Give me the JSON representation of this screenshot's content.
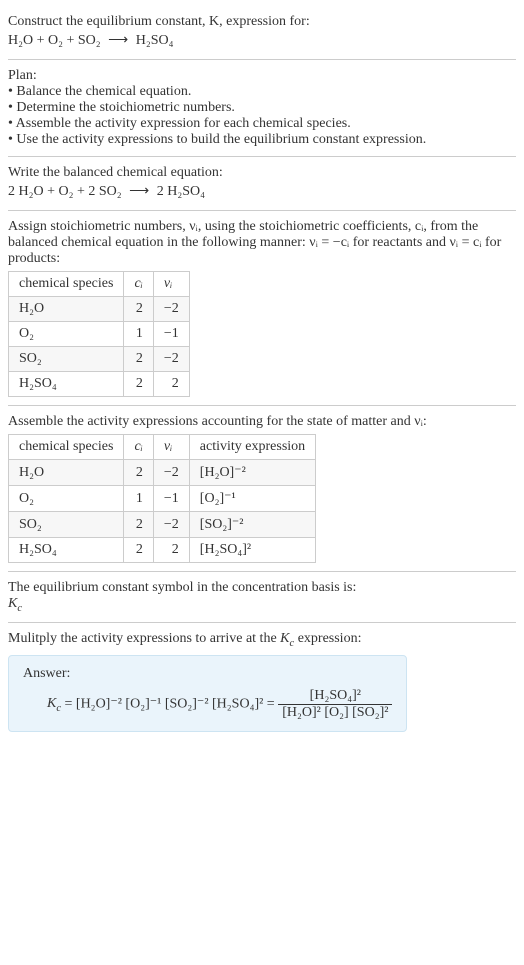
{
  "prompt": {
    "line1": "Construct the equilibrium constant, K, expression for:",
    "eq_left": "H₂O + O₂ + SO₂",
    "eq_right": "H₂SO₄"
  },
  "plan": {
    "title": "Plan:",
    "items": [
      "• Balance the chemical equation.",
      "• Determine the stoichiometric numbers.",
      "• Assemble the activity expression for each chemical species.",
      "• Use the activity expressions to build the equilibrium constant expression."
    ]
  },
  "balanced": {
    "title": "Write the balanced chemical equation:",
    "eq_left": "2 H₂O + O₂ + 2 SO₂",
    "eq_right": "2 H₂SO₄"
  },
  "stoich": {
    "intro_a": "Assign stoichiometric numbers, νᵢ, using the stoichiometric coefficients, cᵢ, from the balanced chemical equation in the following manner: νᵢ = −cᵢ for reactants and νᵢ = cᵢ for products:",
    "headers": {
      "species": "chemical species",
      "ci": "cᵢ",
      "vi": "νᵢ"
    },
    "rows": [
      {
        "species": "H₂O",
        "ci": "2",
        "vi": "−2"
      },
      {
        "species": "O₂",
        "ci": "1",
        "vi": "−1"
      },
      {
        "species": "SO₂",
        "ci": "2",
        "vi": "−2"
      },
      {
        "species": "H₂SO₄",
        "ci": "2",
        "vi": "2"
      }
    ]
  },
  "activity": {
    "intro": "Assemble the activity expressions accounting for the state of matter and νᵢ:",
    "headers": {
      "species": "chemical species",
      "ci": "cᵢ",
      "vi": "νᵢ",
      "expr": "activity expression"
    },
    "rows": [
      {
        "species": "H₂O",
        "ci": "2",
        "vi": "−2",
        "expr": "[H₂O]⁻²"
      },
      {
        "species": "O₂",
        "ci": "1",
        "vi": "−1",
        "expr": "[O₂]⁻¹"
      },
      {
        "species": "SO₂",
        "ci": "2",
        "vi": "−2",
        "expr": "[SO₂]⁻²"
      },
      {
        "species": "H₂SO₄",
        "ci": "2",
        "vi": "2",
        "expr": "[H₂SO₄]²"
      }
    ]
  },
  "kc_symbol": {
    "line1": "The equilibrium constant symbol in the concentration basis is:",
    "line2": "K_c"
  },
  "final": {
    "intro": "Mulitply the activity expressions to arrive at the K_c expression:",
    "answer_label": "Answer:",
    "kc_eq_left": "K_c = [H₂O]⁻² [O₂]⁻¹ [SO₂]⁻² [H₂SO₄]² =",
    "frac_num": "[H₂SO₄]²",
    "frac_den": "[H₂O]² [O₂] [SO₂]²"
  }
}
